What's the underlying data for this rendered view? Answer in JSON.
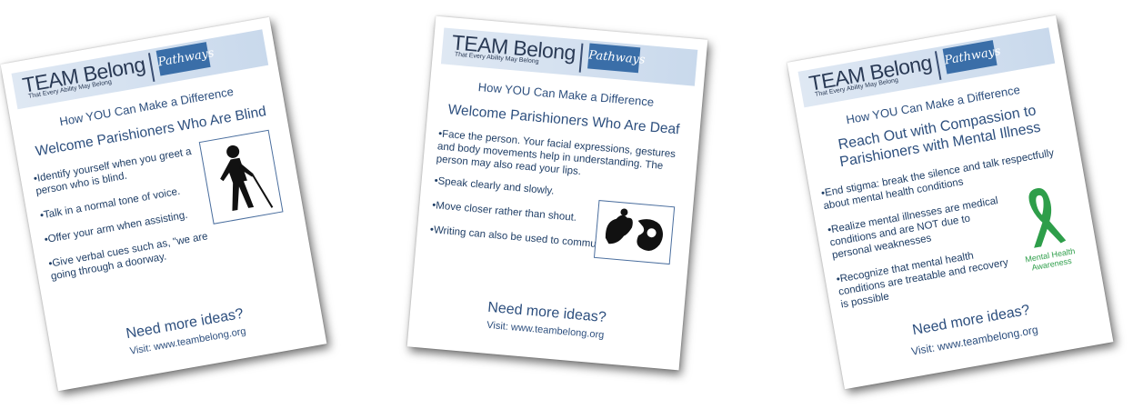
{
  "brand": {
    "name": "TEAM Belong",
    "tagline": "That Every Ability May Belong",
    "partner": "Pathways"
  },
  "cards": [
    {
      "subtitle": "How YOU Can Make a Difference",
      "title": "Welcome Parishioners Who Are Blind",
      "tips": [
        "Identify yourself when you greet a person who is blind.",
        "Talk in a normal tone of voice.",
        "Offer your arm when assisting.",
        "Give verbal cues such as, \"we are going through a doorway."
      ],
      "icon": "blind-person-with-cane-icon",
      "more": "Need more ideas?",
      "visit": "Visit: www.teambelong.org"
    },
    {
      "subtitle": "How YOU Can Make a Difference",
      "title": "Welcome Parishioners Who Are Deaf",
      "tips": [
        "Face the person. Your facial expressions, gestures and body movements help in understanding. The person may also read your lips.",
        "Speak clearly and slowly.",
        "Move closer rather than shout.",
        "Writing can also be used to communicate."
      ],
      "icon": "sign-language-hands-icon",
      "more": "Need more ideas?",
      "visit": "Visit: www.teambelong.org"
    },
    {
      "subtitle": "How YOU Can Make a Difference",
      "title_line1": "Reach Out with Compassion to",
      "title_line2": "Parishioners with Mental Illness",
      "tips": [
        "End stigma: break the silence and talk respectfully about mental health conditions",
        "Realize mental illnesses are medical conditions and are NOT due to personal weaknesses",
        "Recognize that mental health conditions are treatable and recovery is possible"
      ],
      "icon": "green-awareness-ribbon-icon",
      "ribbon_label_1": "Mental Health",
      "ribbon_label_2": "Awareness",
      "more": "Need more ideas?",
      "visit": "Visit: www.teambelong.org"
    }
  ],
  "colors": {
    "text": "#2d4f7e",
    "header_band": "#c9d9ec",
    "partner_badge": "#3a6ea8",
    "ribbon": "#2e9e4a"
  }
}
